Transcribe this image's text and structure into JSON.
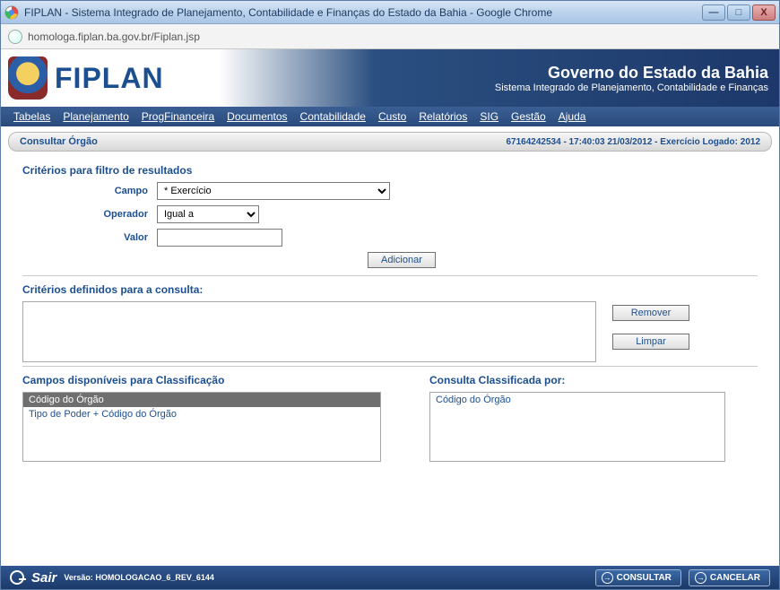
{
  "chrome": {
    "title": "FIPLAN - Sistema Integrado de Planejamento, Contabilidade e Finanças do Estado da Bahia - Google Chrome",
    "url": "homologa.fiplan.ba.gov.br/Fiplan.jsp",
    "min": "—",
    "max": "□",
    "close": "X"
  },
  "header": {
    "logo_text": "FIPLAN",
    "gov": "Governo do Estado da Bahia",
    "sub": "Sistema Integrado de Planejamento, Contabilidade e Finanças"
  },
  "menu": {
    "items": [
      "Tabelas",
      "Planejamento",
      "ProgFinanceira",
      "Documentos",
      "Contabilidade",
      "Custo",
      "Relatórios",
      "SIG",
      "Gestão",
      "Ajuda"
    ]
  },
  "page": {
    "title": "Consultar Órgão",
    "meta": "67164242534 - 17:40:03 21/03/2012 - Exercício Logado: 2012"
  },
  "filter": {
    "section_title": "Critérios para filtro de resultados",
    "campo_label": "Campo",
    "campo_value": "* Exercício",
    "operador_label": "Operador",
    "operador_value": "Igual a",
    "valor_label": "Valor",
    "valor_value": "",
    "add_label": "Adicionar"
  },
  "criteria": {
    "title": "Critérios definidos para a consulta:",
    "text": "",
    "remove_label": "Remover",
    "clear_label": "Limpar"
  },
  "classification": {
    "available_title": "Campos disponíveis para Classificação",
    "available": [
      "Código do Órgão",
      "Tipo de Poder + Código do Órgão"
    ],
    "selected_title": "Consulta Classificada por:",
    "selected": [
      "Código do Órgão"
    ]
  },
  "footer": {
    "exit": "Sair",
    "version": "Versão: HOMOLOGACAO_6_REV_6144",
    "consult": "CONSULTAR",
    "cancel": "CANCELAR"
  }
}
